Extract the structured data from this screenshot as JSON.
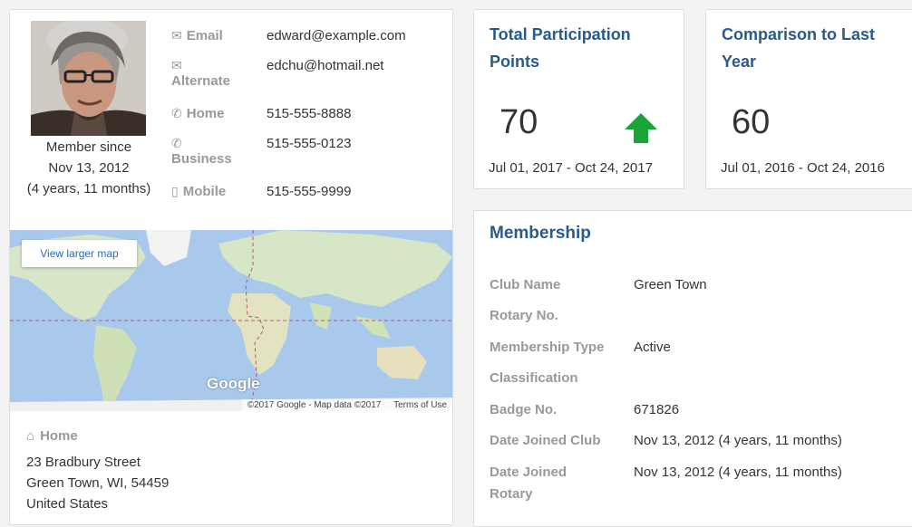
{
  "profile": {
    "member_since_label": "Member since",
    "member_since_date": "Nov 13, 2012",
    "member_duration": "(4 years, 11 months)",
    "contacts": [
      {
        "icon": "envelope-icon",
        "label": "Email",
        "value": "edward@example.com"
      },
      {
        "icon": "envelope-icon",
        "label": "Alternate",
        "value": "edchu@hotmail.net"
      },
      {
        "icon": "phone-icon",
        "label": "Home",
        "value": "515-555-8888"
      },
      {
        "icon": "phone-icon",
        "label": "Business",
        "value": "515-555-0123"
      },
      {
        "icon": "mobile-icon",
        "label": "Mobile",
        "value": "515-555-9999"
      }
    ]
  },
  "map": {
    "view_larger_label": "View larger map",
    "google_label": "Google",
    "credit": "©2017 Google - Map data ©2017",
    "terms": "Terms of Use"
  },
  "address": {
    "label": "Home",
    "line1": "23 Bradbury Street",
    "line2": "Green Town, WI, 54459",
    "line3": "United States"
  },
  "stats": {
    "total": {
      "title": "Total Participation Points",
      "value": "70",
      "range": "Jul 01, 2017 - Oct 24, 2017",
      "trend": "up",
      "trend_color": "#1aa53a"
    },
    "comparison": {
      "title": "Comparison to Last Year",
      "value": "60",
      "range": "Jul 01, 2016 - Oct 24, 2016"
    }
  },
  "membership": {
    "title": "Membership",
    "rows": [
      {
        "label": "Club Name",
        "value": "Green Town"
      },
      {
        "label": "Rotary No.",
        "value": ""
      },
      {
        "label": "Membership Type",
        "value": "Active"
      },
      {
        "label": "Classification",
        "value": ""
      },
      {
        "label": "Badge No.",
        "value": "671826"
      },
      {
        "label": "Date Joined Club",
        "value": "Nov 13, 2012 (4 years, 11 months)"
      },
      {
        "label": "Date Joined Rotary",
        "value": "Nov 13, 2012 (4 years, 11 months)"
      }
    ]
  },
  "colors": {
    "title_blue": "#2a5a8a",
    "label_gray": "#999999",
    "map_water": "#a8c8ec"
  }
}
